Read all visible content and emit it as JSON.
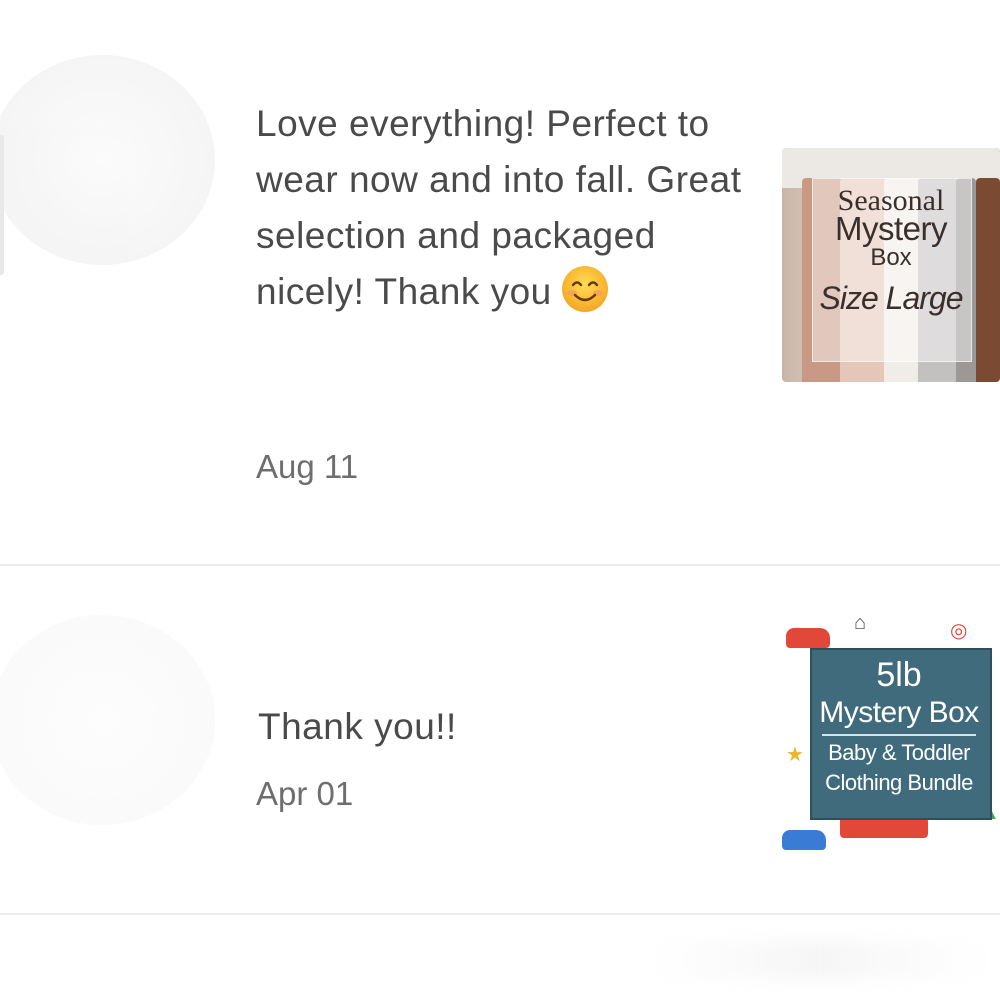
{
  "reviews": [
    {
      "text": "Love everything! Perfect to wear now and into fall. Great selection and packaged nicely! Thank you",
      "emoji": "smiling-face-emoji",
      "date": "Aug 11",
      "product": {
        "line1": "Seasonal",
        "line2": "Mystery",
        "line3": "Box",
        "line4": "Size Large"
      }
    },
    {
      "text": "Thank you!!",
      "date": "Apr 01",
      "product": {
        "line1": "5lb",
        "line2": "Mystery Box",
        "line3": "Baby & Toddler",
        "line4": "Clothing Bundle"
      }
    }
  ],
  "colors": {
    "text": "#4a4a4a",
    "date": "#6e6e6e",
    "divider": "#ececec",
    "panel_teal": "#3f6b7d",
    "emoji_yellow": "#f7b733"
  }
}
